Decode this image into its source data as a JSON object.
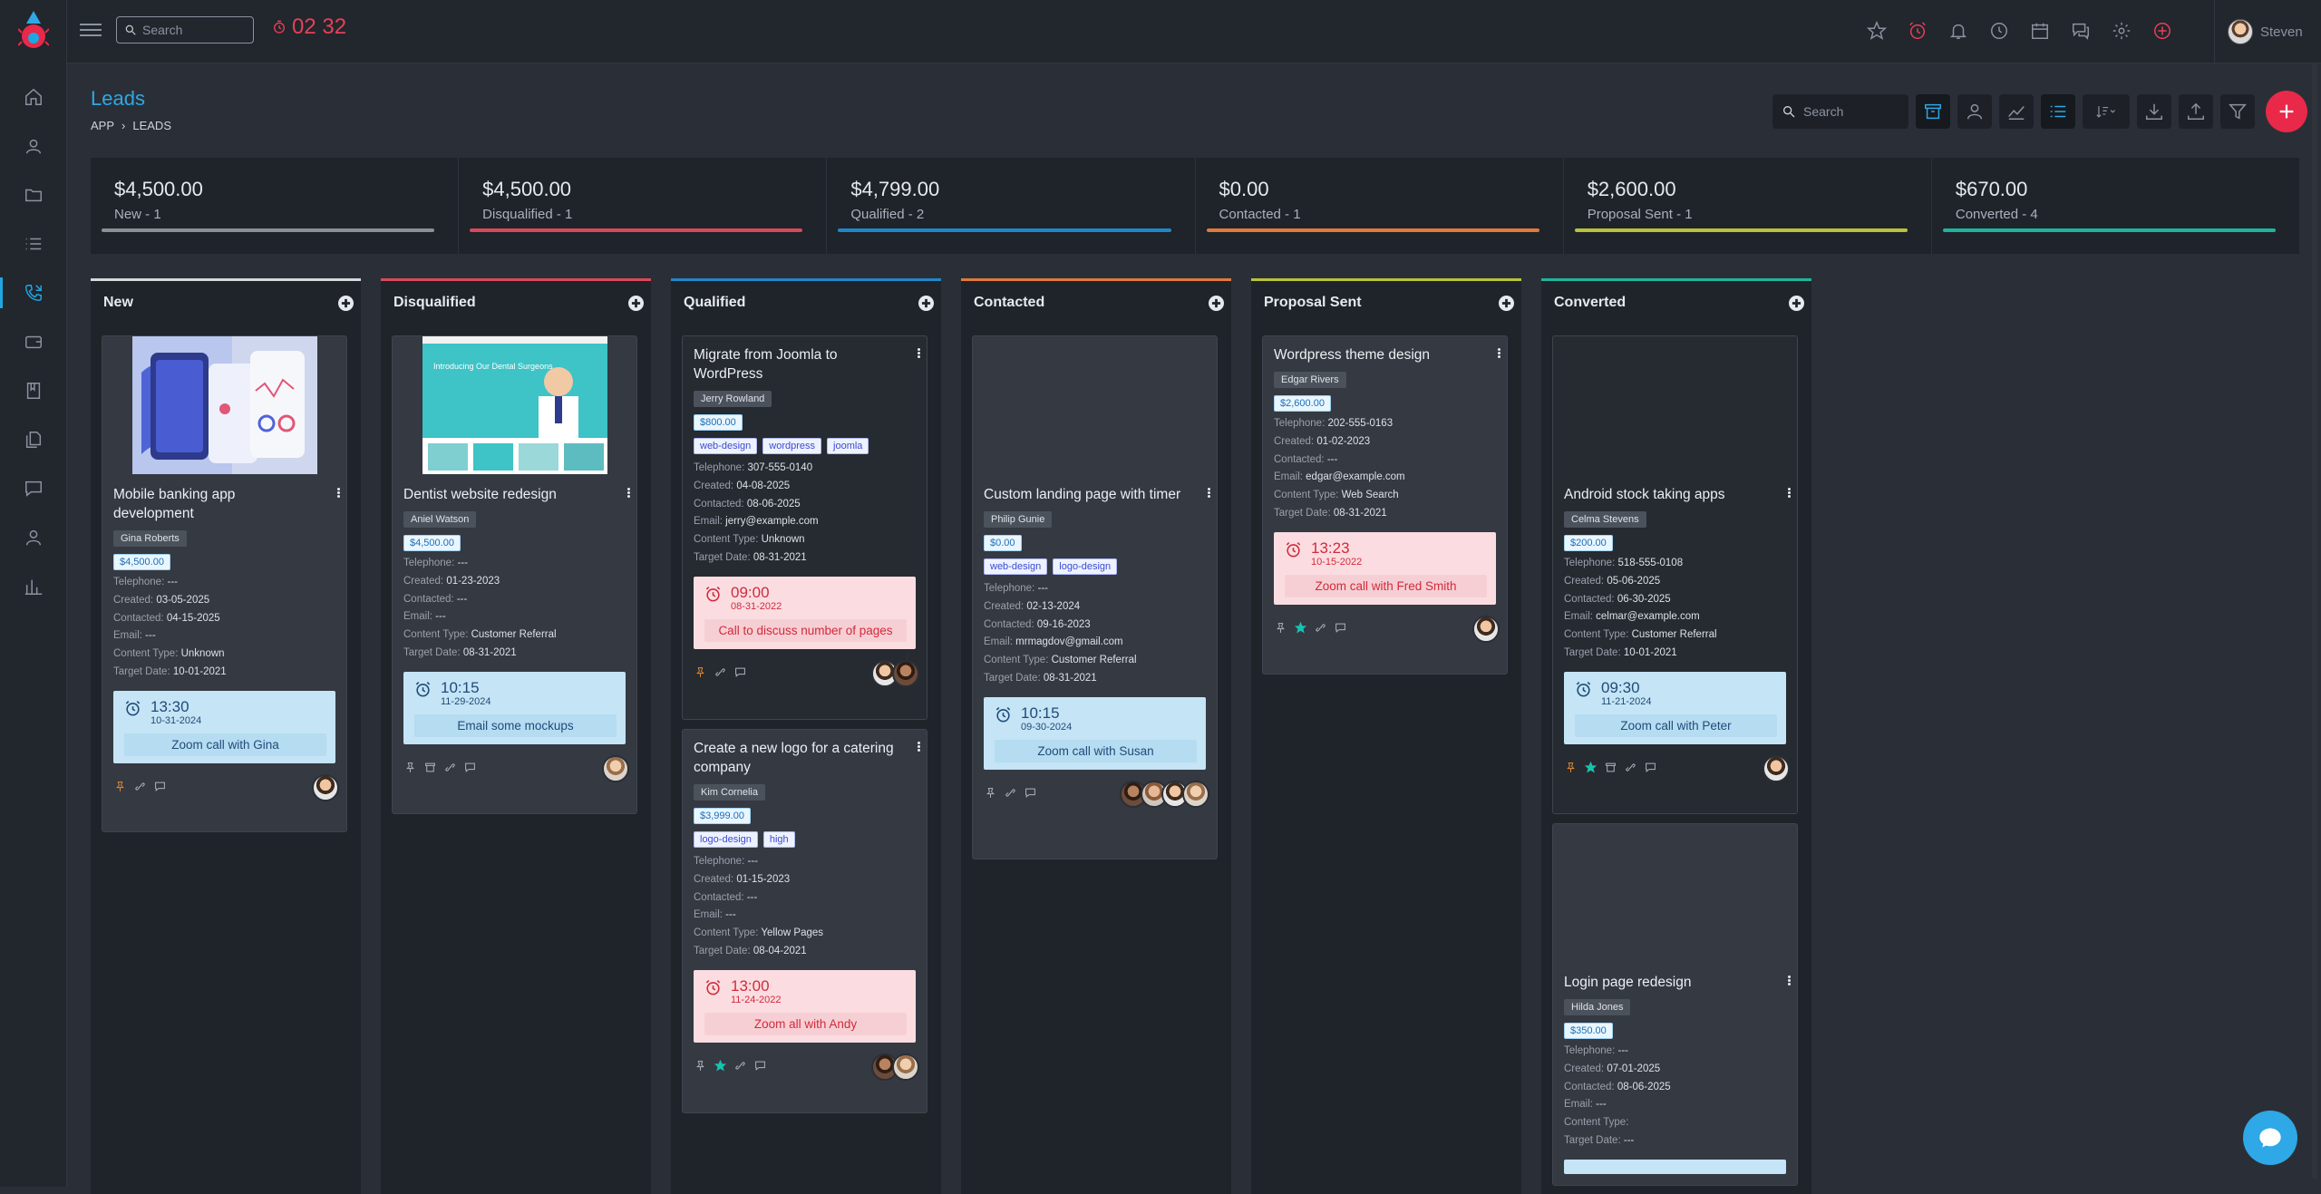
{
  "topbar": {
    "search_placeholder": "Search",
    "timer": "02 32",
    "user_name": "Steven"
  },
  "page": {
    "title": "Leads",
    "breadcrumb": [
      "APP",
      "LEADS"
    ],
    "search_placeholder": "Search"
  },
  "stats": [
    {
      "amount": "$4,500.00",
      "label": "New - 1",
      "color": "#8c8f94"
    },
    {
      "amount": "$4,500.00",
      "label": "Disqualified - 1",
      "color": "#d9485a"
    },
    {
      "amount": "$4,799.00",
      "label": "Qualified - 2",
      "color": "#1e88c7"
    },
    {
      "amount": "$0.00",
      "label": "Contacted - 1",
      "color": "#e07a3a"
    },
    {
      "amount": "$2,600.00",
      "label": "Proposal Sent - 1",
      "color": "#b9c23a"
    },
    {
      "amount": "$670.00",
      "label": "Converted - 4",
      "color": "#1fb59b"
    }
  ],
  "columns": {
    "new": {
      "title": "New",
      "color": "#d5d7db"
    },
    "disqualified": {
      "title": "Disqualified",
      "color": "#d9485a"
    },
    "qualified": {
      "title": "Qualified",
      "color": "#1e88c7"
    },
    "contacted": {
      "title": "Contacted",
      "color": "#e07a3a"
    },
    "proposal": {
      "title": "Proposal Sent",
      "color": "#b9c23a"
    },
    "converted": {
      "title": "Converted",
      "color": "#1fb59b"
    }
  },
  "labels": {
    "telephone": "Telephone:",
    "created": "Created:",
    "contacted": "Contacted:",
    "email": "Email:",
    "content_type": "Content Type:",
    "target_date": "Target Date:"
  },
  "cards": {
    "c1": {
      "title": "Mobile banking app development",
      "owner": "Gina Roberts",
      "price": "$4,500.00",
      "telephone": "---",
      "created": "03-05-2025",
      "contacted": "04-15-2025",
      "email": "---",
      "content_type": "Unknown",
      "target_date": "10-01-2021",
      "rem_time": "13:30",
      "rem_date": "10-31-2024",
      "rem_desc": "Zoom call with Gina"
    },
    "c2": {
      "title": "Dentist website redesign",
      "owner": "Aniel Watson",
      "price": "$4,500.00",
      "telephone": "---",
      "created": "01-23-2023",
      "contacted": "---",
      "email": "---",
      "content_type": "Customer Referral",
      "target_date": "08-31-2021",
      "rem_time": "10:15",
      "rem_date": "11-29-2024",
      "rem_desc": "Email some mockups",
      "img_text": "Introducing Our Dental Surgeons"
    },
    "c3": {
      "title": "Migrate from Joomla to WordPress",
      "owner": "Jerry Rowland",
      "price": "$800.00",
      "tags": [
        "web-design",
        "wordpress",
        "joomla"
      ],
      "telephone": "307-555-0140",
      "created": "04-08-2025",
      "contacted": "08-06-2025",
      "email": "jerry@example.com",
      "content_type": "Unknown",
      "target_date": "08-31-2021",
      "rem_time": "09:00",
      "rem_date": "08-31-2022",
      "rem_desc": "Call to discuss number of pages"
    },
    "c4": {
      "title": "Create a new logo for a catering company",
      "owner": "Kim Cornelia",
      "price": "$3,999.00",
      "tags": [
        "logo-design",
        "high"
      ],
      "telephone": "---",
      "created": "01-15-2023",
      "contacted": "---",
      "email": "---",
      "content_type": "Yellow Pages",
      "target_date": "08-04-2021",
      "rem_time": "13:00",
      "rem_date": "11-24-2022",
      "rem_desc": "Zoom all with Andy"
    },
    "c5": {
      "title": "Custom landing page with timer",
      "owner": "Philip Gunie",
      "price": "$0.00",
      "tags": [
        "web-design",
        "logo-design"
      ],
      "telephone": "---",
      "created": "02-13-2024",
      "contacted": "09-16-2023",
      "email": "mrmagdov@gmail.com",
      "content_type": "Customer Referral",
      "target_date": "08-31-2021",
      "rem_time": "10:15",
      "rem_date": "09-30-2024",
      "rem_desc": "Zoom call with Susan"
    },
    "c6": {
      "title": "Wordpress theme design",
      "owner": "Edgar Rivers",
      "price": "$2,600.00",
      "telephone": "202-555-0163",
      "created": "01-02-2023",
      "contacted": "---",
      "email": "edgar@example.com",
      "content_type": "Web Search",
      "target_date": "08-31-2021",
      "rem_time": "13:23",
      "rem_date": "10-15-2022",
      "rem_desc": "Zoom call with Fred Smith"
    },
    "c7": {
      "title": "Android stock taking apps",
      "owner": "Celma Stevens",
      "price": "$200.00",
      "telephone": "518-555-0108",
      "created": "05-06-2025",
      "contacted": "06-30-2025",
      "email": "celmar@example.com",
      "content_type": "Customer Referral",
      "target_date": "10-01-2021",
      "rem_time": "09:30",
      "rem_date": "11-21-2024",
      "rem_desc": "Zoom call with Peter"
    },
    "c8": {
      "title": "Login page redesign",
      "owner": "Hilda Jones",
      "price": "$350.00",
      "telephone": "---",
      "created": "07-01-2025",
      "contacted": "08-06-2025",
      "email": "---",
      "content_type": "",
      "target_date": "---"
    }
  },
  "icons": [
    "home-icon",
    "contacts-icon",
    "folder-icon",
    "list-icon",
    "phone-icon",
    "wallet-icon",
    "book-icon",
    "files-icon",
    "chat-icon",
    "user-icon",
    "bar-chart-icon"
  ]
}
